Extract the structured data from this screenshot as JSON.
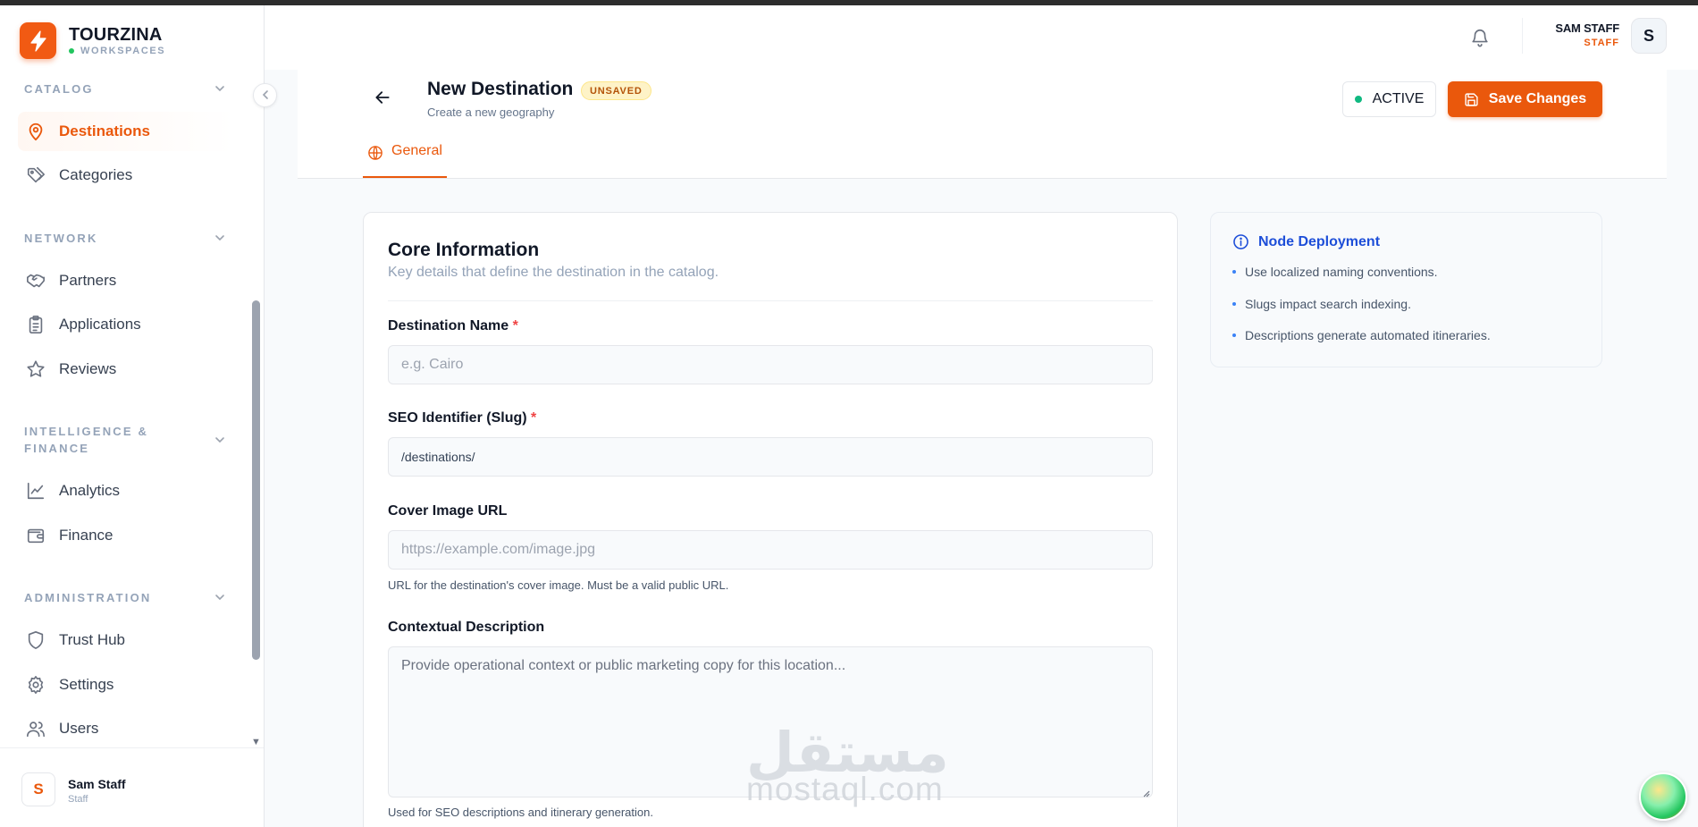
{
  "brand": {
    "name": "TOURZINA",
    "sub": "WORKSPACES"
  },
  "sidebar": {
    "sections": [
      {
        "title": "CATALOG",
        "items": [
          {
            "label": "Destinations",
            "icon": "map-pin-icon",
            "active": true
          },
          {
            "label": "Categories",
            "icon": "tags-icon"
          }
        ]
      },
      {
        "title": "NETWORK",
        "items": [
          {
            "label": "Partners",
            "icon": "handshake-icon"
          },
          {
            "label": "Applications",
            "icon": "clipboard-list-icon"
          },
          {
            "label": "Reviews",
            "icon": "star-icon"
          }
        ]
      },
      {
        "title": "INTELLIGENCE & FINANCE",
        "items": [
          {
            "label": "Analytics",
            "icon": "line-chart-icon"
          },
          {
            "label": "Finance",
            "icon": "wallet-icon"
          }
        ]
      },
      {
        "title": "ADMINISTRATION",
        "items": [
          {
            "label": "Trust Hub",
            "icon": "shield-icon"
          },
          {
            "label": "Settings",
            "icon": "gear-icon"
          },
          {
            "label": "Users",
            "icon": "users-icon"
          }
        ]
      }
    ],
    "footer": {
      "avatar_letter": "S",
      "name": "Sam Staff",
      "role": "Staff"
    }
  },
  "topbar": {
    "user_name": "SAM STAFF",
    "user_role": "STAFF",
    "avatar_letter": "S"
  },
  "page": {
    "title": "New Destination",
    "badge": "UNSAVED",
    "subtitle": "Create a new geography",
    "status_label": "ACTIVE",
    "save_label": "Save Changes",
    "tabs": [
      {
        "label": "General",
        "icon": "globe-icon"
      }
    ]
  },
  "form": {
    "title": "Core Information",
    "subtitle": "Key details that define the destination in the catalog.",
    "fields": {
      "name": {
        "label": "Destination Name",
        "required_mark": "*",
        "placeholder": "e.g. Cairo",
        "value": ""
      },
      "slug": {
        "label": "SEO Identifier (Slug)",
        "required_mark": "*",
        "value": "/destinations/"
      },
      "cover": {
        "label": "Cover Image URL",
        "placeholder": "https://example.com/image.jpg",
        "help": "URL for the destination's cover image. Must be a valid public URL."
      },
      "description": {
        "label": "Contextual Description",
        "placeholder": "Provide operational context or public marketing copy for this location...",
        "help": "Used for SEO descriptions and itinerary generation."
      }
    }
  },
  "info": {
    "title": "Node Deployment",
    "items": [
      "Use localized naming conventions.",
      "Slugs impact search indexing.",
      "Descriptions generate automated itineraries."
    ]
  },
  "watermark": {
    "arabic": "مستقل",
    "latin": "mostaql.com"
  },
  "colors": {
    "accent": "#ea580c",
    "info": "#1d4ed8",
    "status": "#10b981",
    "badge_bg": "#fef3c7"
  }
}
